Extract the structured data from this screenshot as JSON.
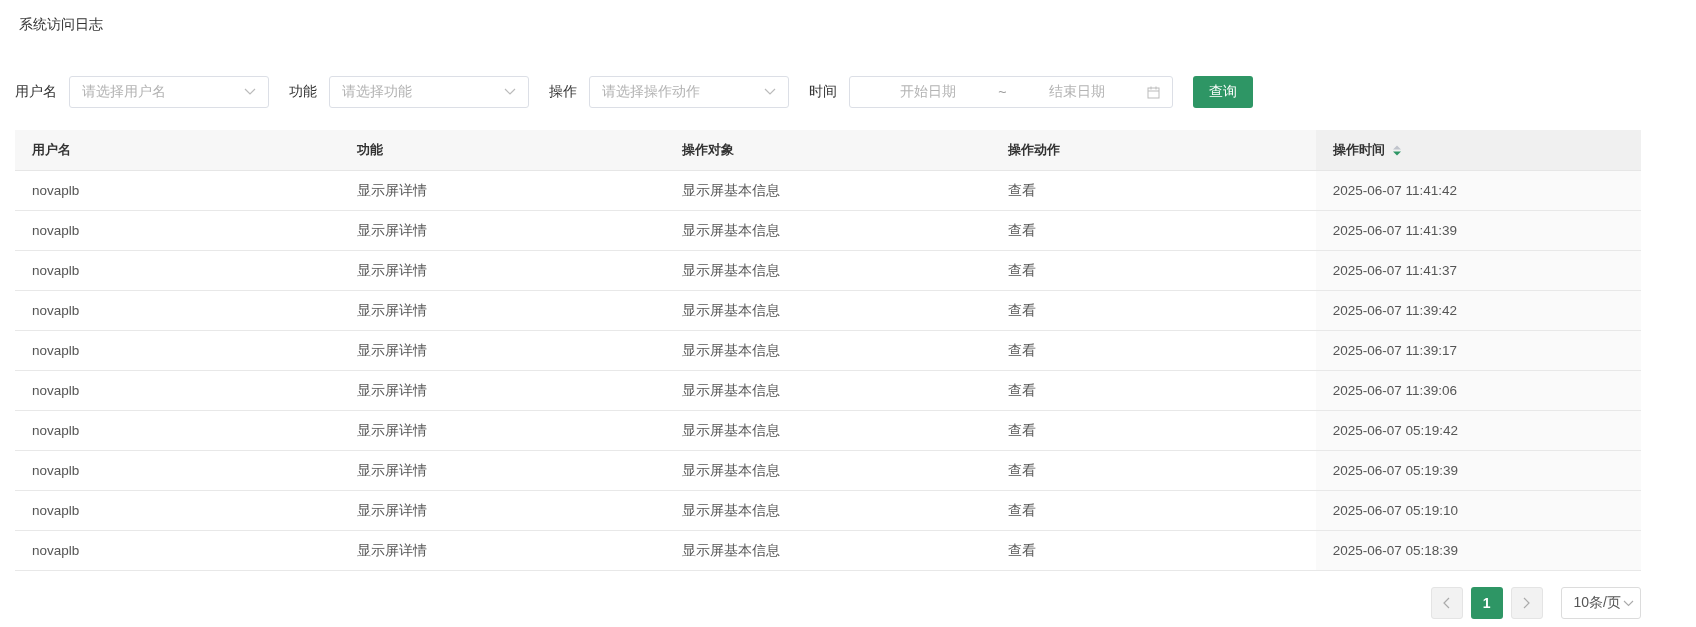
{
  "page_title": "系统访问日志",
  "filters": [
    {
      "label": "用户名",
      "kind": "select",
      "placeholder": "请选择用户名"
    },
    {
      "label": "功能",
      "kind": "select",
      "placeholder": "请选择功能"
    },
    {
      "label": "操作",
      "kind": "select",
      "placeholder": "请选择操作动作"
    },
    {
      "label": "时间",
      "kind": "daterange",
      "start_placeholder": "开始日期",
      "separator": "~",
      "end_placeholder": "结束日期"
    }
  ],
  "query_button": "查询",
  "table": {
    "columns": [
      {
        "label": "用户名"
      },
      {
        "label": "功能"
      },
      {
        "label": "操作对象"
      },
      {
        "label": "操作动作"
      },
      {
        "label": "操作时间",
        "sortable": true,
        "sort_descending": true
      }
    ],
    "rows": [
      [
        "novaplb",
        "显示屏详情",
        "显示屏基本信息",
        "查看",
        "2025-06-07 11:41:42"
      ],
      [
        "novaplb",
        "显示屏详情",
        "显示屏基本信息",
        "查看",
        "2025-06-07 11:41:39"
      ],
      [
        "novaplb",
        "显示屏详情",
        "显示屏基本信息",
        "查看",
        "2025-06-07 11:41:37"
      ],
      [
        "novaplb",
        "显示屏详情",
        "显示屏基本信息",
        "查看",
        "2025-06-07 11:39:42"
      ],
      [
        "novaplb",
        "显示屏详情",
        "显示屏基本信息",
        "查看",
        "2025-06-07 11:39:17"
      ],
      [
        "novaplb",
        "显示屏详情",
        "显示屏基本信息",
        "查看",
        "2025-06-07 11:39:06"
      ],
      [
        "novaplb",
        "显示屏详情",
        "显示屏基本信息",
        "查看",
        "2025-06-07 05:19:42"
      ],
      [
        "novaplb",
        "显示屏详情",
        "显示屏基本信息",
        "查看",
        "2025-06-07 05:19:39"
      ],
      [
        "novaplb",
        "显示屏详情",
        "显示屏基本信息",
        "查看",
        "2025-06-07 05:19:10"
      ],
      [
        "novaplb",
        "显示屏详情",
        "显示屏基本信息",
        "查看",
        "2025-06-07 05:18:39"
      ]
    ]
  },
  "pagination": {
    "prev_disabled": true,
    "next_disabled": true,
    "pages": [
      {
        "label": "1",
        "selected": true
      }
    ],
    "page_size": "10条/页"
  }
}
